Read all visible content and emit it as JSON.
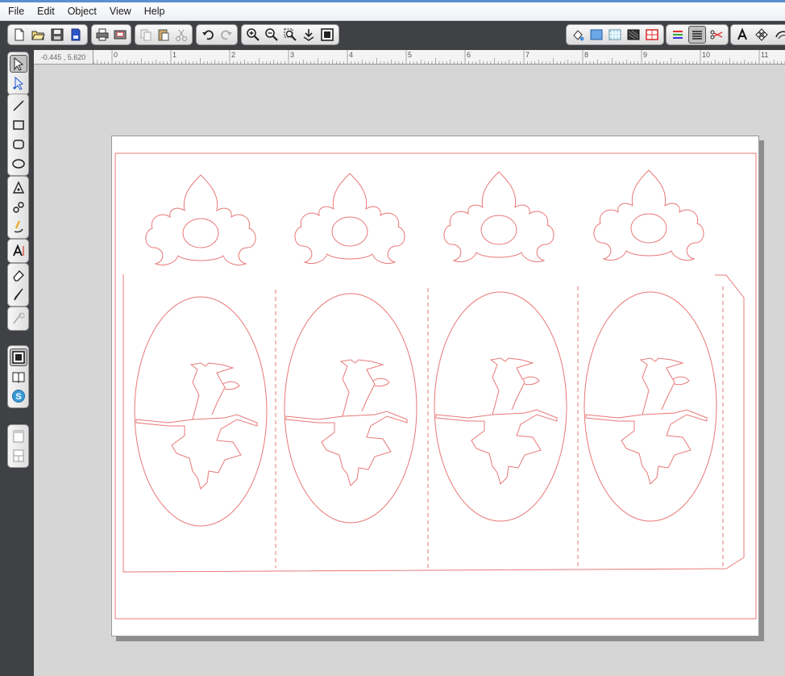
{
  "menu": {
    "items": [
      {
        "label": "File"
      },
      {
        "label": "Edit"
      },
      {
        "label": "Object"
      },
      {
        "label": "View"
      },
      {
        "label": "Help"
      }
    ]
  },
  "ruler": {
    "coords": "-0.445 , 5.620",
    "numbers": [
      "0",
      "1",
      "2",
      "3",
      "4",
      "5",
      "6",
      "7",
      "8",
      "9",
      "10",
      "11"
    ]
  },
  "toolbar": {
    "file_icons": [
      "new-document-icon",
      "open-folder-icon",
      "save-icon",
      "save-to-sd-icon"
    ],
    "output_icons": [
      "print-icon",
      "send-to-cutter-icon"
    ],
    "clipboard_icons": [
      "copy-icon",
      "paste-icon",
      "cut-icon"
    ],
    "history_icons": [
      "undo-icon",
      "redo-icon"
    ],
    "zoom_icons": [
      "zoom-in-icon",
      "zoom-out-icon",
      "zoom-selection-icon",
      "fit-page-icon",
      "zoom-to-page-icon"
    ],
    "panel_icons": [
      "fill-panel-icon",
      "color-panel-icon",
      "pattern-panel-icon",
      "texture-panel-icon",
      "grid-panel-icon",
      "line-panel-icon",
      "page-setup-icon",
      "cut-settings-icon",
      "font-icon",
      "replicate-icon",
      "offset-icon"
    ]
  },
  "colors": {
    "cut_line": "#e87878",
    "chrome_dark": "#3f4144",
    "workspace": "#d6d6d6"
  }
}
